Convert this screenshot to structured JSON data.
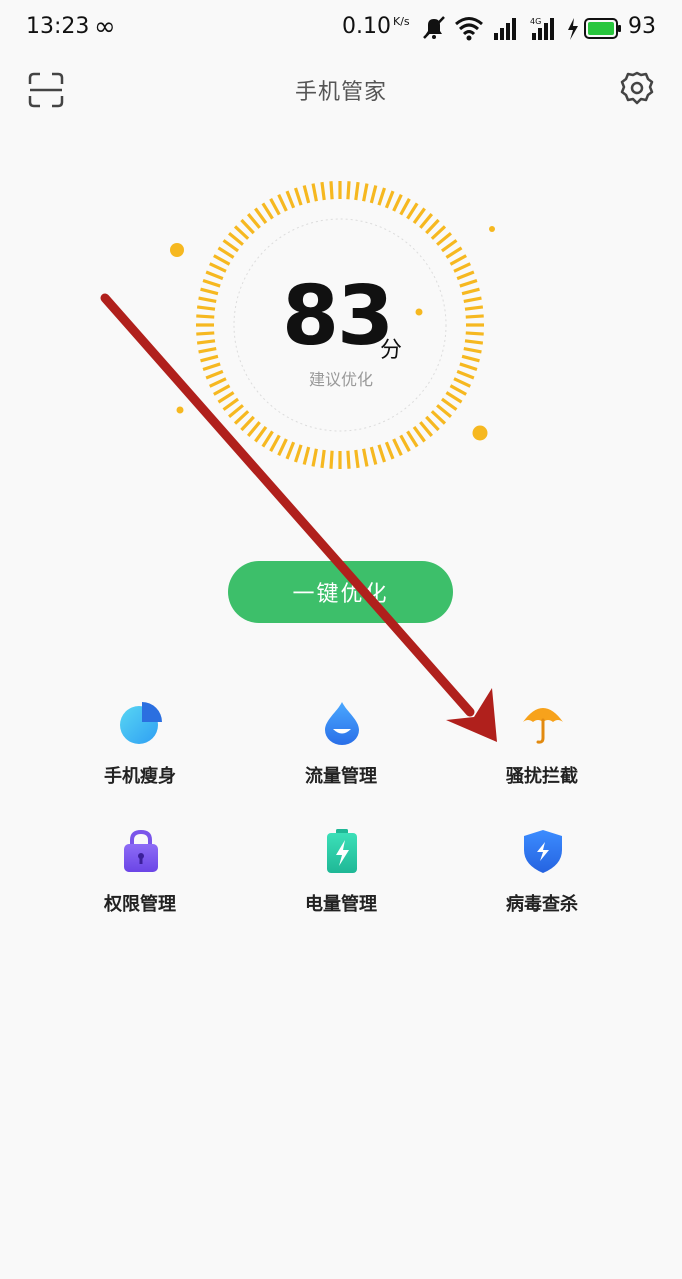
{
  "status_bar": {
    "time": "13:23",
    "loop_icon": "∞",
    "net_speed": "0.10",
    "net_unit": "K/s",
    "battery": "93"
  },
  "app_bar": {
    "title": "手机管家"
  },
  "score": {
    "value": "83",
    "unit": "分",
    "status": "建议优化"
  },
  "optimize_button": {
    "label": "一键优化"
  },
  "tools": [
    {
      "label": "手机瘦身",
      "icon": "storage-cleanup-icon"
    },
    {
      "label": "流量管理",
      "icon": "data-drop-icon"
    },
    {
      "label": "骚扰拦截",
      "icon": "umbrella-icon"
    },
    {
      "label": "权限管理",
      "icon": "lock-icon"
    },
    {
      "label": "电量管理",
      "icon": "battery-icon"
    },
    {
      "label": "病毒查杀",
      "icon": "shield-icon"
    }
  ],
  "colors": {
    "accent_green": "#3dbf6a",
    "dial_orange": "#f6b820",
    "arrow_red": "#b0201c"
  }
}
